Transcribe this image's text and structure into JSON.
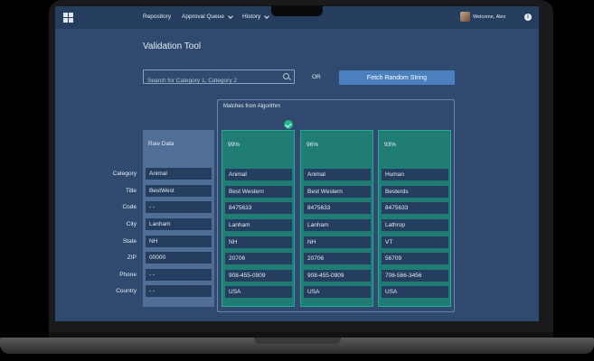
{
  "nav": {
    "items": [
      {
        "label": "Repository",
        "has_chevron": false
      },
      {
        "label": "Approval Queue",
        "has_chevron": true
      },
      {
        "label": "History",
        "has_chevron": true
      }
    ],
    "welcome": "Welcome, Alex",
    "info_icon": "i"
  },
  "page": {
    "title": "Validation Tool",
    "search_placeholder": "Search for Category 1, Category 2",
    "or_text": "OR",
    "fetch_label": "Fetch Random String",
    "matches_label": "Matches from Algorithm"
  },
  "fields": [
    "Category",
    "Title",
    "Code",
    "City",
    "State",
    "ZIP",
    "Phone",
    "Country"
  ],
  "raw": {
    "header": "Raw Data",
    "values": [
      "Animal",
      "BestWest",
      "- -",
      "Lanham",
      "NH",
      "00000",
      "- -",
      "- -"
    ]
  },
  "matches": [
    {
      "score": "99%",
      "values": [
        "Animal",
        "Best Western",
        "8475633",
        "Lanham",
        "NH",
        "20706",
        "908-455-0909",
        "USA"
      ]
    },
    {
      "score": "96%",
      "values": [
        "Animal",
        "Best Western",
        "8475633",
        "Lanham",
        "NH",
        "20706",
        "908-455-0909",
        "USA"
      ]
    },
    {
      "score": "93%",
      "values": [
        "Human",
        "Besterds",
        "8475633",
        "Lathrop",
        "VT",
        "56709",
        "708-566-3456",
        "USA"
      ]
    }
  ],
  "colors": {
    "screen_bg": "#2f4a6e",
    "nav_bg": "#253d5f",
    "accent_button": "#4a7fc0",
    "match_column": "#1f7d75",
    "check": "#22b78a"
  }
}
